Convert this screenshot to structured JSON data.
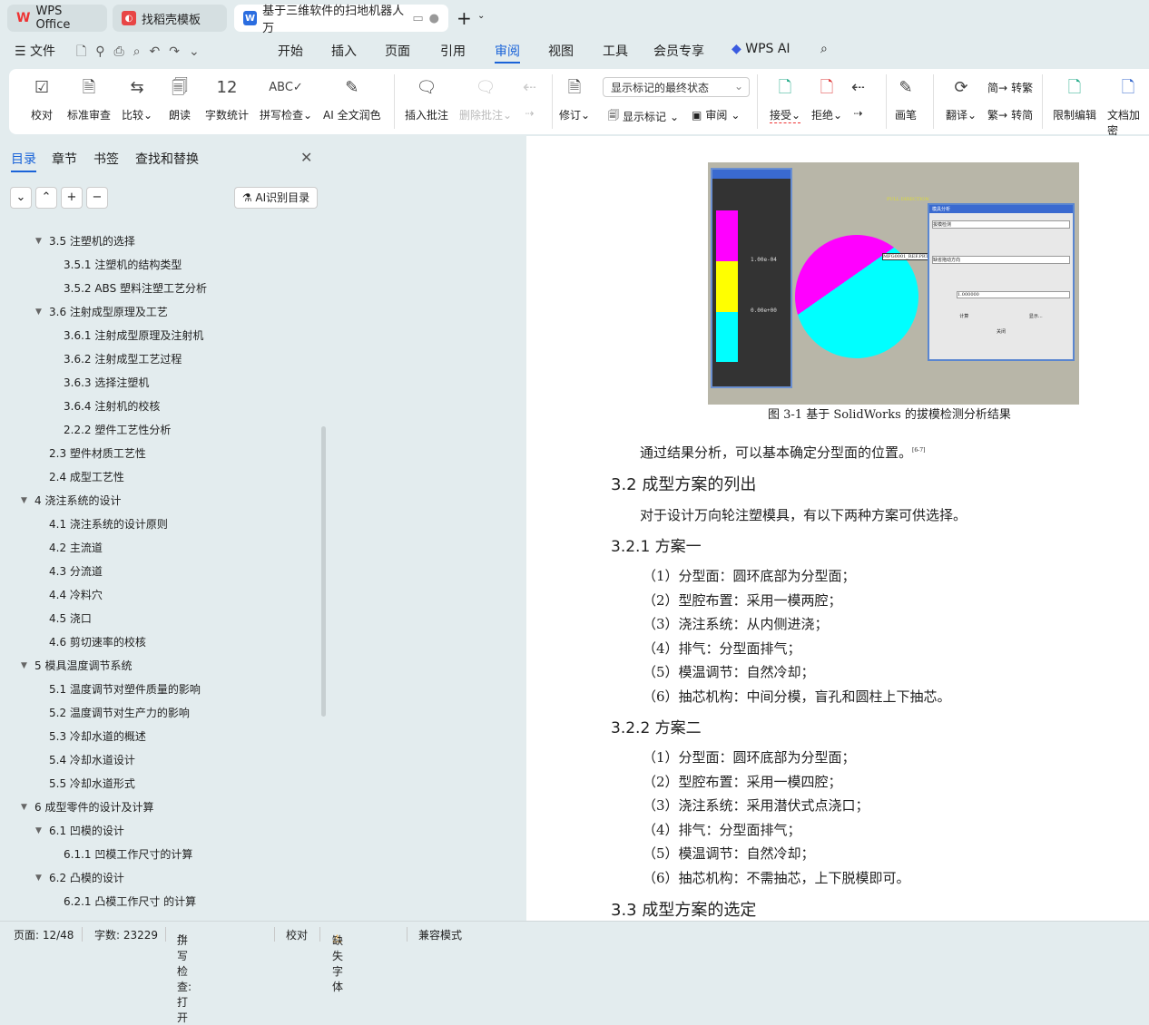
{
  "tabs": [
    {
      "label": "WPS Office"
    },
    {
      "label": "找稻壳模板"
    },
    {
      "label": "基于三维软件的扫地机器人万"
    }
  ],
  "menu": {
    "file": "文件",
    "items": [
      "开始",
      "插入",
      "页面",
      "引用",
      "审阅",
      "视图",
      "工具",
      "会员专享"
    ],
    "ai": "WPS AI"
  },
  "ribbon": {
    "proof": "校对",
    "standard": "标准审查",
    "compare": "比较",
    "read": "朗读",
    "wordcount": "字数统计",
    "spell": "拼写检查",
    "ai_polish": "AI 全文润色",
    "insert_comment": "插入批注",
    "delete_comment": "删除批注",
    "revise": "修订",
    "markup_select": "显示标记的最终状态",
    "show_markup": "显示标记",
    "review": "审阅",
    "accept": "接受",
    "reject": "拒绝",
    "pen": "画笔",
    "translate": "翻译",
    "to_trad": "转繁",
    "to_simp": "转简",
    "restrict": "限制编辑",
    "encrypt": "文档加密"
  },
  "sidebar": {
    "tabs": [
      "目录",
      "章节",
      "书签",
      "查找和替换"
    ],
    "ai_toc": "AI识别目录",
    "toc": [
      {
        "level": 2,
        "label": "3.5  注塑机的选择",
        "expand": true
      },
      {
        "level": 3,
        "label": "3.5.1  注塑机的结构类型"
      },
      {
        "level": 3,
        "label": "3.5.2 ABS 塑料注塑工艺分析"
      },
      {
        "level": 2,
        "label": "3.6  注射成型原理及工艺",
        "expand": true
      },
      {
        "level": 3,
        "label": "3.6.1  注射成型原理及注射机"
      },
      {
        "level": 3,
        "label": "3.6.2  注射成型工艺过程"
      },
      {
        "level": 3,
        "label": "3.6.3  选择注塑机"
      },
      {
        "level": 3,
        "label": "3.6.4  注射机的校核"
      },
      {
        "level": 3,
        "label": "2.2.2  塑件工艺性分析"
      },
      {
        "level": 2,
        "label": "2.3  塑件材质工艺性"
      },
      {
        "level": 2,
        "label": "2.4  成型工艺性"
      },
      {
        "level": 1,
        "label": "4  浇注系统的设计",
        "expand": true
      },
      {
        "level": 2,
        "label": "4.1  浇注系统的设计原则"
      },
      {
        "level": 2,
        "label": "4.2  主流道"
      },
      {
        "level": 2,
        "label": "4.3  分流道"
      },
      {
        "level": 2,
        "label": "4.4  冷料穴"
      },
      {
        "level": 2,
        "label": "4.5  浇口"
      },
      {
        "level": 2,
        "label": "4.6  剪切速率的校核"
      },
      {
        "level": 1,
        "label": "5  模具温度调节系统",
        "expand": true
      },
      {
        "level": 2,
        "label": "5.1  温度调节对塑件质量的影响"
      },
      {
        "level": 2,
        "label": "5.2  温度调节对生产力的影响"
      },
      {
        "level": 2,
        "label": "5.3  冷却水道的概述"
      },
      {
        "level": 2,
        "label": "5.4  冷却水道设计"
      },
      {
        "level": 2,
        "label": "5.5  冷却水道形式"
      },
      {
        "level": 1,
        "label": "6  成型零件的设计及计算",
        "expand": true
      },
      {
        "level": 2,
        "label": "6.1  凹模的设计",
        "expand": true
      },
      {
        "level": 3,
        "label": "6.1.1  凹模工作尺寸的计算"
      },
      {
        "level": 2,
        "label": "6.2  凸模的设计",
        "expand": true
      },
      {
        "level": 3,
        "label": "6.2.1  凸模工作尺寸 的计算"
      }
    ]
  },
  "doc": {
    "figure": {
      "caption": "图 3-1 基于 SolidWorks 的拔模检测分析结果",
      "legend_top": "1.00e-04",
      "legend_bottom": "0.00e+00",
      "pull": "PULL DIRECTION",
      "part": "MFG0001_REF.PRT",
      "dialog_title": "模具分析",
      "dialog_type": "拔模检测",
      "dialog_dir": "缺省拖动方向",
      "dialog_angle": "1.000000",
      "btn_calc": "计算",
      "btn_show": "显示...",
      "btn_close": "关闭"
    },
    "p1": "通过结果分析，可以基本确定分型面的位置。",
    "cite": "[6-7]",
    "h32": "3.2  成型方案的列出",
    "p2": "对于设计万向轮注塑模具，有以下两种方案可供选择。",
    "h321": "3.2.1  方案一",
    "plan1": [
      "（1）分型面：圆环底部为分型面；",
      "（2）型腔布置：采用一模两腔；",
      "（3）浇注系统：从内侧进浇；",
      "（4）排气：分型面排气；",
      "（5）模温调节：自然冷却；",
      "（6）抽芯机构：中间分模，盲孔和圆柱上下抽芯。"
    ],
    "h322": "3.2.2  方案二",
    "plan2": [
      "（1）分型面：圆环底部为分型面；",
      "（2）型腔布置：采用一模四腔；",
      "（3）浇注系统：采用潜伏式点浇口；",
      "（4）排气：分型面排气；",
      "（5）模温调节：自然冷却；",
      "（6）抽芯机构：不需抽芯，上下脱模即可。"
    ],
    "h33": "3.3  成型方案的选定"
  },
  "status": {
    "page": "页面: 12/48",
    "words": "字数: 23229",
    "spell": "拼写检查: 打开",
    "proof": "校对",
    "missing_font": "缺失字体",
    "compat": "兼容模式"
  }
}
